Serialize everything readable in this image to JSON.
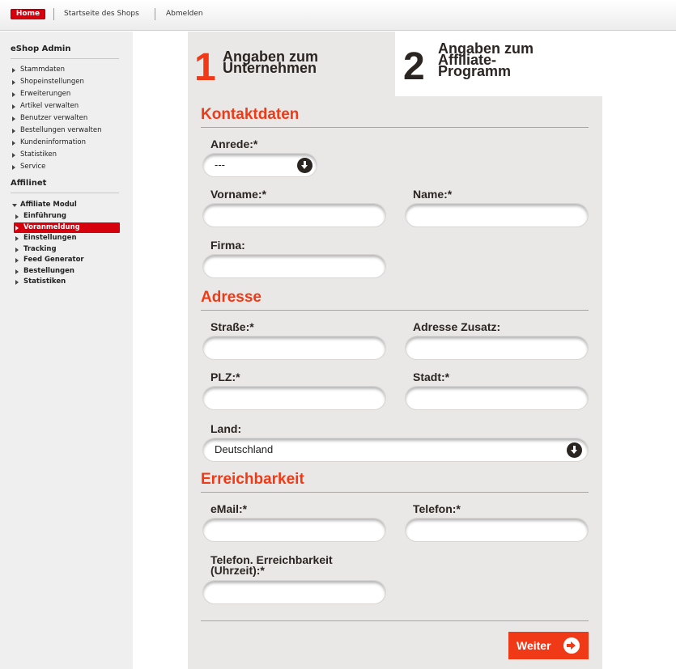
{
  "topbar": {
    "home": "Home",
    "shop_home": "Startseite des Shops",
    "logout": "Abmelden"
  },
  "sidebar": {
    "title_eshop": "eShop Admin",
    "eshop_items": [
      "Stammdaten",
      "Shopeinstellungen",
      "Erweiterungen",
      "Artikel verwalten",
      "Benutzer verwalten",
      "Bestellungen verwalten",
      "Kundeninformation",
      "Statistiken",
      "Service"
    ],
    "title_affilinet": "Affilinet",
    "module_title": "Affiliate Modul",
    "module_items": [
      "Einführung",
      "Voranmeldung",
      "Einstellungen",
      "Tracking",
      "Feed Generator",
      "Bestellungen",
      "Statistiken"
    ],
    "active_item": "Voranmeldung"
  },
  "steps": [
    {
      "number": "1",
      "label": "Angaben zum\nUnternehmen"
    },
    {
      "number": "2",
      "label": "Angaben zum\nAffiliate-\nProgramm"
    }
  ],
  "sections": {
    "contact": "Kontaktdaten",
    "address": "Adresse",
    "reachability": "Erreichbarkeit"
  },
  "fields": {
    "salutation": {
      "label": "Anrede:*",
      "value": "---"
    },
    "firstname": {
      "label": "Vorname:*",
      "value": ""
    },
    "name": {
      "label": "Name:*",
      "value": ""
    },
    "company": {
      "label": "Firma:",
      "value": ""
    },
    "street": {
      "label": "Straße:*",
      "value": ""
    },
    "address_extra": {
      "label": "Adresse Zusatz:",
      "value": ""
    },
    "zip": {
      "label": "PLZ:*",
      "value": ""
    },
    "city": {
      "label": "Stadt:*",
      "value": ""
    },
    "country": {
      "label": "Land:",
      "value": "Deutschland"
    },
    "email": {
      "label": "eMail:*",
      "value": ""
    },
    "phone": {
      "label": "Telefon:*",
      "value": ""
    },
    "phone_time": {
      "label": "Telefon. Erreichbarkeit\n(Uhrzeit):*",
      "value": ""
    }
  },
  "buttons": {
    "next": "Weiter"
  },
  "colors": {
    "accent": "#f03a17",
    "brand_red": "#d6000d",
    "panel": "#eae8e6",
    "text_dark": "#2b2522"
  }
}
